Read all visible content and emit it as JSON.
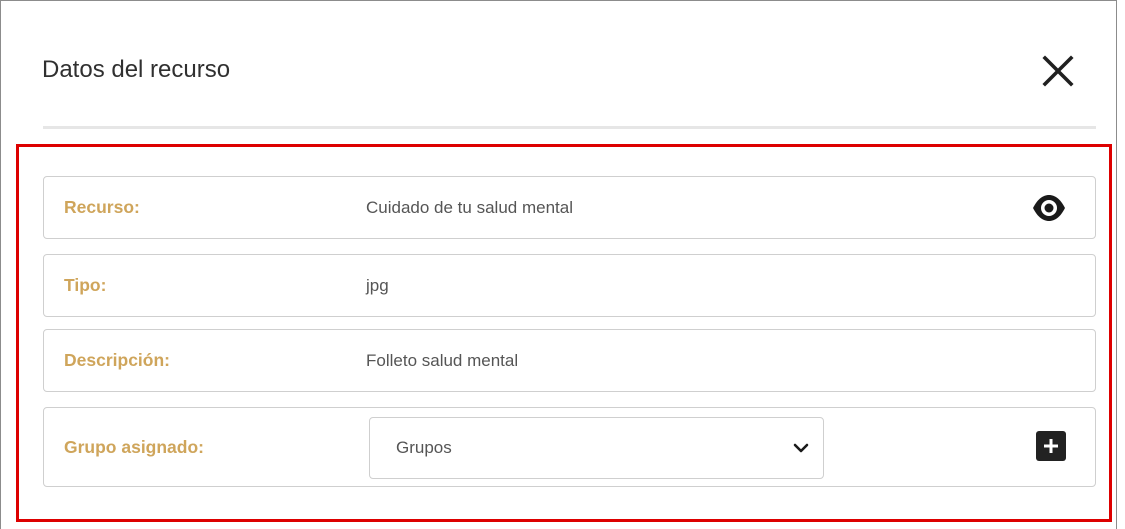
{
  "modal": {
    "title": "Datos del recurso"
  },
  "fields": {
    "recurso": {
      "label": "Recurso:",
      "value": "Cuidado de tu salud mental"
    },
    "tipo": {
      "label": "Tipo:",
      "value": "jpg"
    },
    "descripcion": {
      "label": "Descripción:",
      "value": "Folleto salud mental"
    },
    "grupo": {
      "label": "Grupo asignado:",
      "select_value": "Grupos"
    }
  },
  "icons": {
    "close": "close-icon",
    "view": "eye-icon",
    "dropdown": "chevron-down-icon",
    "add": "plus-icon"
  },
  "colors": {
    "label": "#cfa55b",
    "highlight": "#dd0000",
    "add_button": "#222222"
  }
}
